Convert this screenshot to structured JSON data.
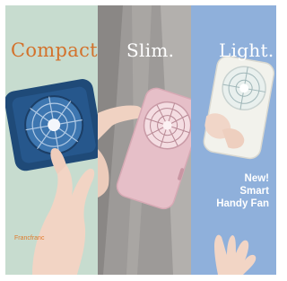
{
  "panels": {
    "compact": {
      "headline": "Compact.",
      "brand": "Francfranc",
      "background": "#c7dccf",
      "accent": "#d3722c"
    },
    "slim": {
      "headline": "Slim.",
      "background": "#9e9b99"
    },
    "light": {
      "headline": "Light.",
      "tagline": [
        "New!",
        "Smart",
        "Handy Fan"
      ],
      "background": "#8fb0db"
    }
  },
  "products": {
    "compact_fan_color": "#1f4a78",
    "slim_fan_color": "#e6bfc8",
    "light_fan_color": "#f2f2ec"
  }
}
